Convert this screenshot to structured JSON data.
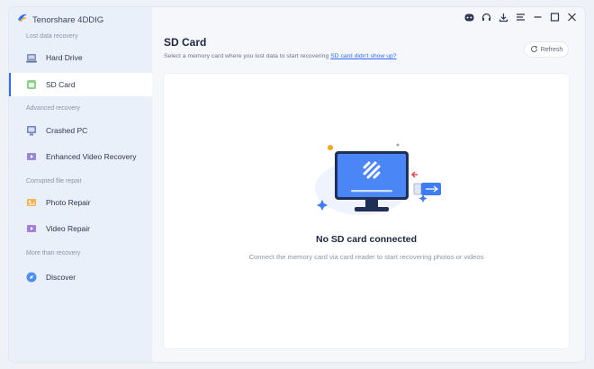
{
  "app": {
    "title": "Tenorshare 4DDIG"
  },
  "sidebar": {
    "sections": [
      {
        "label": "Lost data recovery"
      },
      {
        "label": "Advanced recovery"
      },
      {
        "label": "Corrupted file repair"
      },
      {
        "label": "More than recovery"
      }
    ],
    "items": [
      {
        "label": "Hard Drive",
        "icon": "hard-drive-icon"
      },
      {
        "label": "SD Card",
        "icon": "sd-card-icon",
        "active": true
      },
      {
        "label": "Crashed PC",
        "icon": "crashed-pc-icon"
      },
      {
        "label": "Enhanced Video Recovery",
        "icon": "video-recovery-icon"
      },
      {
        "label": "Photo Repair",
        "icon": "photo-repair-icon"
      },
      {
        "label": "Video Repair",
        "icon": "video-repair-icon"
      },
      {
        "label": "Discover",
        "icon": "discover-icon"
      }
    ]
  },
  "main": {
    "title": "SD Card",
    "subtitle": "Select a memory card where you lost data to start recovering",
    "subtitle_link": "SD card didn't show up?",
    "refresh_label": "Refresh",
    "empty_title": "No SD card connected",
    "empty_desc": "Connect the memory card via card reader to start recovering photos or videos"
  },
  "titlebar": {
    "icons": [
      "discord-icon",
      "headset-icon",
      "download-icon",
      "menu-icon",
      "minimize-icon",
      "maximize-icon",
      "close-icon"
    ]
  },
  "colors": {
    "accent": "#2f6bff",
    "sidebar_bg": "#eaf0fa",
    "monitor_blue": "#3f7bf3"
  }
}
